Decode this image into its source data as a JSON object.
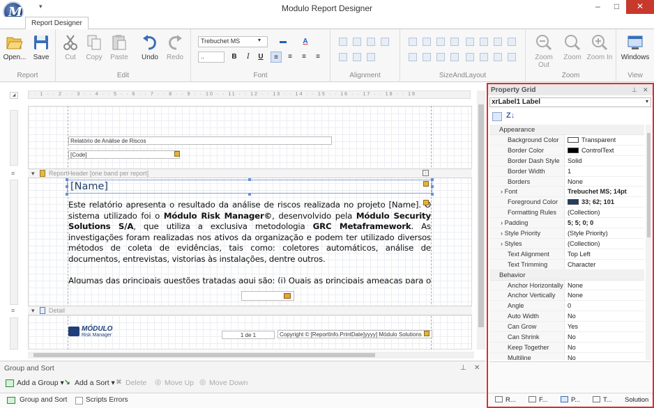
{
  "window": {
    "title": "Modulo Report Designer",
    "min": "–",
    "max": "□",
    "close": "✕"
  },
  "tabs": [
    "Report Designer"
  ],
  "ribbon": {
    "report": {
      "label": "Report",
      "open": "Open...",
      "save": "Save"
    },
    "edit": {
      "label": "Edit",
      "cut": "Cut",
      "copy": "Copy",
      "paste": "Paste",
      "undo": "Undo",
      "redo": "Redo"
    },
    "font": {
      "label": "Font",
      "family": "Trebuchet MS",
      "size": "..",
      "bold": "B",
      "italic": "I",
      "underline": "U",
      "font_color": "A"
    },
    "alignment": {
      "label": "Alignment"
    },
    "sizeandlayout": {
      "label": "SizeAndLayout"
    },
    "zoom": {
      "label": "Zoom",
      "zoom_out": "Zoom Out",
      "zoom": "Zoom",
      "zoom_in": "Zoom In"
    },
    "view": {
      "label": "View",
      "windows": "Windows"
    }
  },
  "ruler": "· · 1 · · 2 · · 3 · · 4 · · 5 · · 6 · · 7 · · 8 · · 9 · · 10 · · 11 · · 12 · · 13 · · 14 · · 15 · · 16 · · 17 · · 18 · · 19",
  "report": {
    "page_header": {
      "title": "Relatório de Análise de Riscos",
      "code": "[Code]"
    },
    "report_header_band": "ReportHeader [one band per report]",
    "name_label": "[Name]",
    "body_p1_a": "Este relatório apresenta o resultado da análise de riscos realizada no projeto [Name]. O sistema utilizado foi o ",
    "body_p1_b": "Módulo Risk Manager©",
    "body_p1_c": ", desenvolvido pela ",
    "body_p1_d": "Módulo Security Solutions S/A",
    "body_p1_e": ", que utiliza a exclusiva metodologia ",
    "body_p1_f": "GRC Metaframework",
    "body_p1_g": ". As investigações foram realizadas nos ativos da organização e podem ter utilizado diversos métodos de coleta de evidências, tais como: coletores automáticos, análise de documentos, entrevistas, vistorias às instalações, dentre outros.",
    "body_p2": "Algumas das principais questões tratadas aqui são: (i) Quais as principais ameaças para o negócio? (ii) Quais os níveis de riscos dos controles não implementados? (iii) Quais as recomendações para",
    "detail_band": "Detail",
    "footer_logo_top": "MÓDULO",
    "footer_logo_bottom": "Risk Manager",
    "footer_page": "1 de 1",
    "footer_copyright": "Copyright © [ReportInfo.PrintDate]yyyy] Módulo Solutions"
  },
  "group_sort": {
    "title": "Group and Sort",
    "add_group": "Add a Group ▾",
    "add_sort": "Add a Sort ▾",
    "delete": "Delete",
    "move_up": "Move Up",
    "move_down": "Move Down",
    "tab_group_sort": "Group and Sort",
    "tab_scripts_errors": "Scripts Errors",
    "pin": "⊥",
    "close": "✕"
  },
  "property_grid": {
    "title": "Property Grid",
    "pin": "⊥",
    "close": "✕",
    "selected": "xrLabel1   Label",
    "categories": [
      {
        "name": "Appearance",
        "rows": [
          {
            "name": "Background Color",
            "value": "Transparent",
            "swatch": "#ffffff"
          },
          {
            "name": "Border Color",
            "value": "ControlText",
            "swatch": "#000000"
          },
          {
            "name": "Border Dash Style",
            "value": "Solid"
          },
          {
            "name": "Border Width",
            "value": "1"
          },
          {
            "name": "Borders",
            "value": "None"
          },
          {
            "name": "Font",
            "value": "Trebuchet MS; 14pt",
            "bold": true,
            "expand": true
          },
          {
            "name": "Foreground Color",
            "value": "33; 62; 101",
            "swatch": "#213e65",
            "bold": true
          },
          {
            "name": "Formatting Rules",
            "value": "(Collection)"
          },
          {
            "name": "Padding",
            "value": "5; 5; 0; 0",
            "bold": true,
            "expand": true
          },
          {
            "name": "Style Priority",
            "value": "(Style Priority)",
            "expand": true
          },
          {
            "name": "Styles",
            "value": "(Collection)",
            "expand": true
          },
          {
            "name": "Text Alignment",
            "value": "Top Left"
          },
          {
            "name": "Text Trimming",
            "value": "Character"
          }
        ]
      },
      {
        "name": "Behavior",
        "rows": [
          {
            "name": "Anchor Horizontally",
            "value": "None"
          },
          {
            "name": "Anchor Vertically",
            "value": "None"
          },
          {
            "name": "Angle",
            "value": "0"
          },
          {
            "name": "Auto Width",
            "value": "No"
          },
          {
            "name": "Can Grow",
            "value": "Yes"
          },
          {
            "name": "Can Shrink",
            "value": "No"
          },
          {
            "name": "Keep Together",
            "value": "No"
          },
          {
            "name": "Multiline",
            "value": "No"
          }
        ]
      }
    ],
    "tabs": [
      "R...",
      "F...",
      "P...",
      "T...",
      "Solution"
    ]
  }
}
